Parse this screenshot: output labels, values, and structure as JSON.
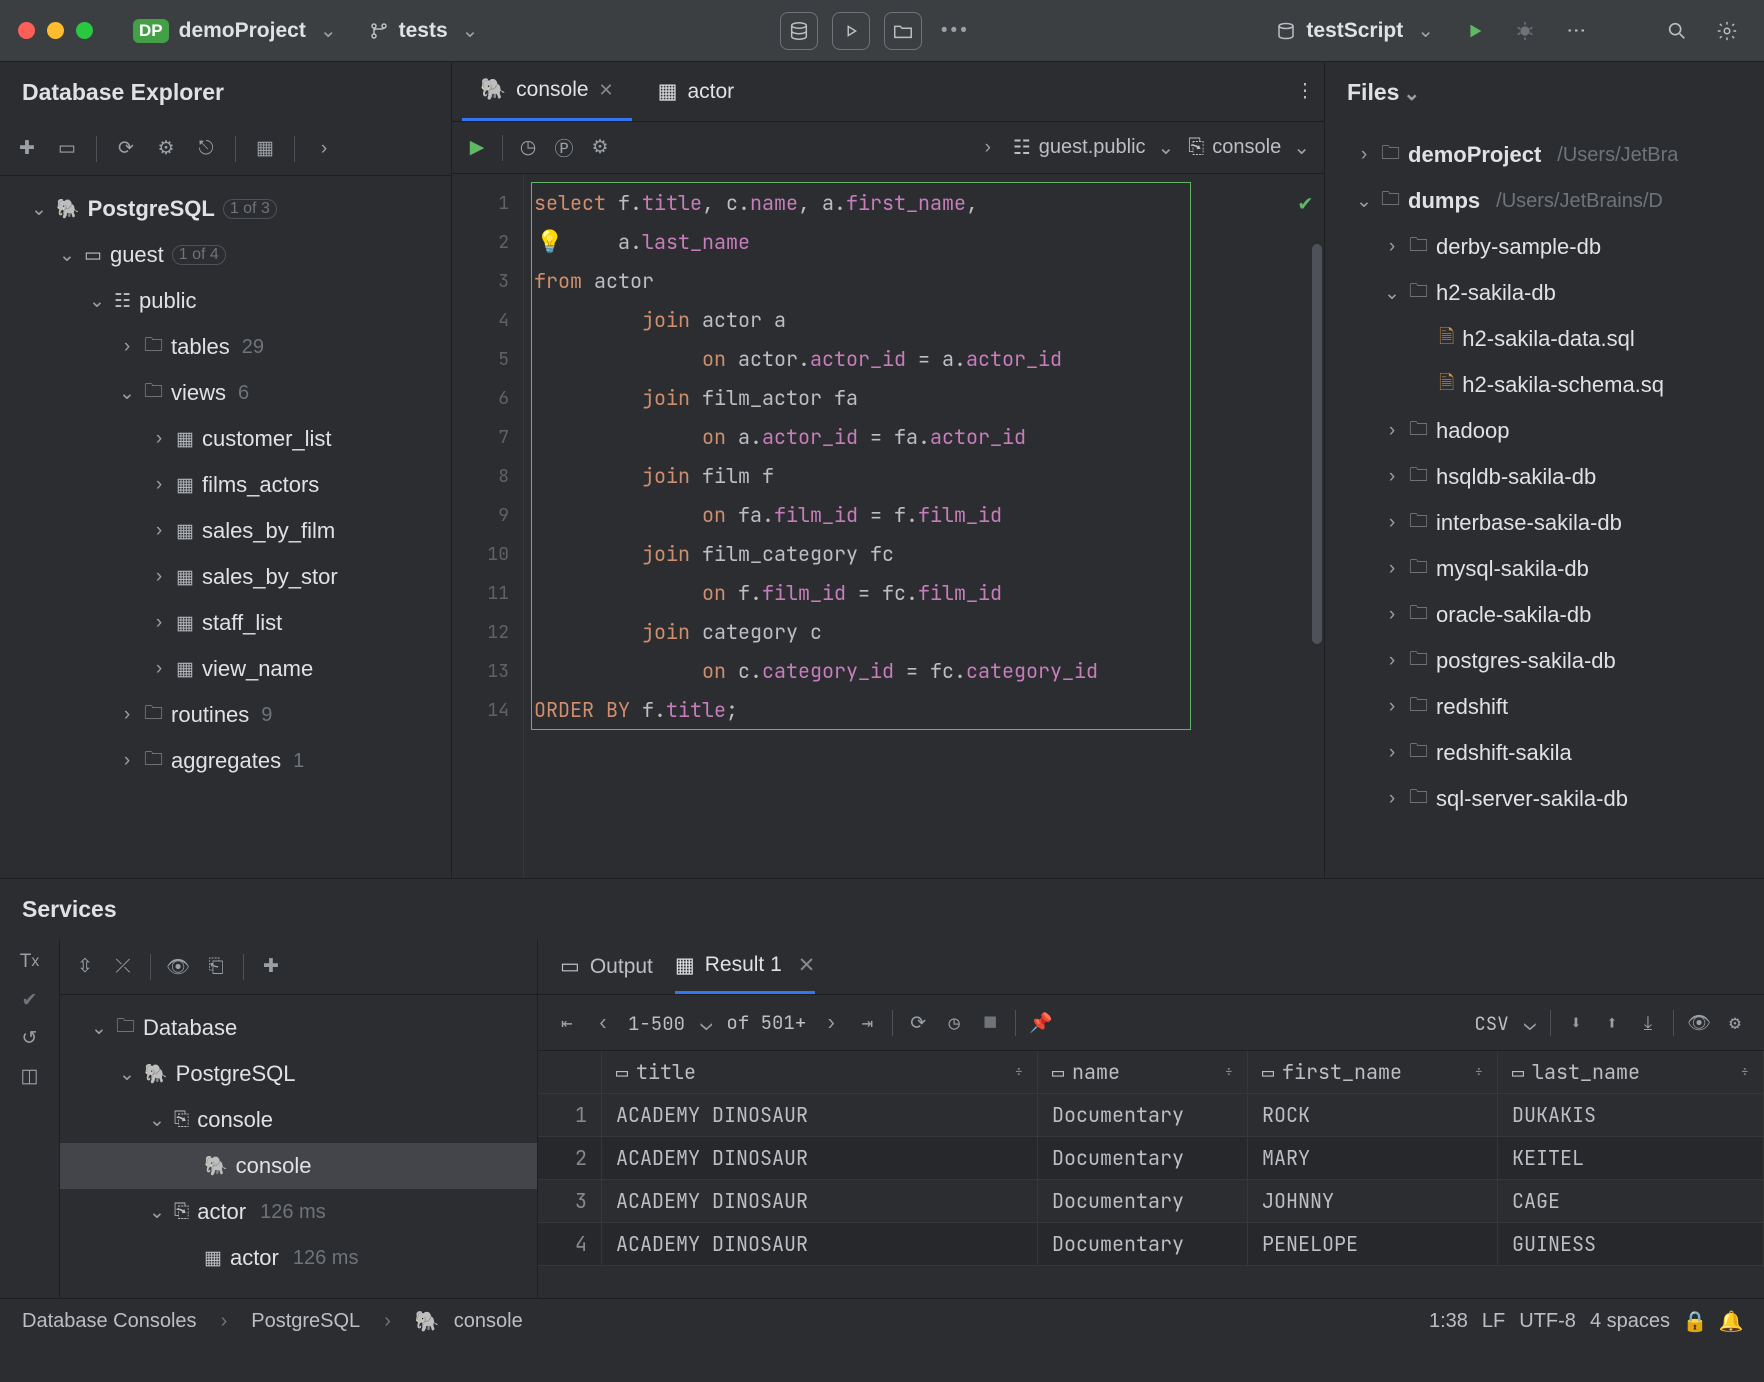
{
  "titlebar": {
    "project_badge": "DP",
    "project_name": "demoProject",
    "branch": "tests",
    "run_config": "testScript"
  },
  "db_explorer": {
    "title": "Database Explorer",
    "root": {
      "label": "PostgreSQL",
      "count": "1 of 3"
    },
    "guest": {
      "label": "guest",
      "count": "1 of 4"
    },
    "public": "public",
    "tables": {
      "label": "tables",
      "count": "29"
    },
    "views": {
      "label": "views",
      "count": "6",
      "items": [
        "customer_list",
        "films_actors",
        "sales_by_film",
        "sales_by_stor",
        "staff_list",
        "view_name"
      ]
    },
    "routines": {
      "label": "routines",
      "count": "9"
    },
    "aggregates": {
      "label": "aggregates",
      "count": "1"
    }
  },
  "editor": {
    "tabs": [
      {
        "label": "console",
        "icon": "pg",
        "active": true,
        "closable": true
      },
      {
        "label": "actor",
        "icon": "table",
        "active": false
      }
    ],
    "datasource": "guest.public",
    "session": "console",
    "lines": [
      1,
      2,
      3,
      4,
      5,
      6,
      7,
      8,
      9,
      10,
      11,
      12,
      13,
      14
    ],
    "code": {
      "l1": {
        "a": "select",
        "b": " f.",
        "c": "title",
        "d": ", c.",
        "e": "name",
        "f": ", a.",
        "g": "first_name",
        "h": ","
      },
      "l2": {
        "a": "       a.",
        "b": "last_name"
      },
      "l3": {
        "a": "from",
        "b": " actor"
      },
      "l4": {
        "a": "         ",
        "b": "join",
        "c": " actor a"
      },
      "l5": {
        "a": "              ",
        "b": "on",
        "c": " actor.",
        "d": "actor_id",
        "e": " = a.",
        "f": "actor_id"
      },
      "l6": {
        "a": "         ",
        "b": "join",
        "c": " film_actor fa"
      },
      "l7": {
        "a": "              ",
        "b": "on",
        "c": " a.",
        "d": "actor_id",
        "e": " = fa.",
        "f": "actor_id"
      },
      "l8": {
        "a": "         ",
        "b": "join",
        "c": " film f"
      },
      "l9": {
        "a": "              ",
        "b": "on",
        "c": " fa.",
        "d": "film_id",
        "e": " = f.",
        "f": "film_id"
      },
      "l10": {
        "a": "         ",
        "b": "join",
        "c": " film_category fc"
      },
      "l11": {
        "a": "              ",
        "b": "on",
        "c": " f.",
        "d": "film_id",
        "e": " = fc.",
        "f": "film_id"
      },
      "l12": {
        "a": "         ",
        "b": "join",
        "c": " category c"
      },
      "l13": {
        "a": "              ",
        "b": "on",
        "c": " c.",
        "d": "category_id",
        "e": " = fc.",
        "f": "category_id"
      },
      "l14": {
        "a": "ORDER BY",
        "b": " f.",
        "c": "title",
        "d": ";"
      }
    }
  },
  "files": {
    "title": "Files",
    "root": {
      "label": "demoProject",
      "path": "/Users/JetBra"
    },
    "dumps": {
      "label": "dumps",
      "path": "/Users/JetBrains/D"
    },
    "derby": "derby-sample-db",
    "h2": {
      "label": "h2-sakila-db",
      "children": [
        "h2-sakila-data.sql",
        "h2-sakila-schema.sq"
      ]
    },
    "rest": [
      "hadoop",
      "hsqldb-sakila-db",
      "interbase-sakila-db",
      "mysql-sakila-db",
      "oracle-sakila-db",
      "postgres-sakila-db",
      "redshift",
      "redshift-sakila",
      "sql-server-sakila-db"
    ]
  },
  "services": {
    "title": "Services",
    "tree": {
      "database": "Database",
      "pg": "PostgreSQL",
      "console": "console",
      "console_leaf": "console",
      "actor": "actor",
      "actor_time": "126 ms",
      "actor_leaf": "actor"
    },
    "output_tab": "Output",
    "result_tab": "Result 1",
    "pager": {
      "range": "1-500",
      "total": "of 501+"
    },
    "export": "CSV",
    "columns": [
      "title",
      "name",
      "first_name",
      "last_name"
    ],
    "rows": [
      [
        "1",
        "ACADEMY DINOSAUR",
        "Documentary",
        "ROCK",
        "DUKAKIS"
      ],
      [
        "2",
        "ACADEMY DINOSAUR",
        "Documentary",
        "MARY",
        "KEITEL"
      ],
      [
        "3",
        "ACADEMY DINOSAUR",
        "Documentary",
        "JOHNNY",
        "CAGE"
      ],
      [
        "4",
        "ACADEMY DINOSAUR",
        "Documentary",
        "PENELOPE",
        "GUINESS"
      ]
    ]
  },
  "status": {
    "crumbs": [
      "Database Consoles",
      "PostgreSQL",
      "console"
    ],
    "pos": "1:38",
    "sep": "LF",
    "enc": "UTF-8",
    "indent": "4 spaces"
  }
}
